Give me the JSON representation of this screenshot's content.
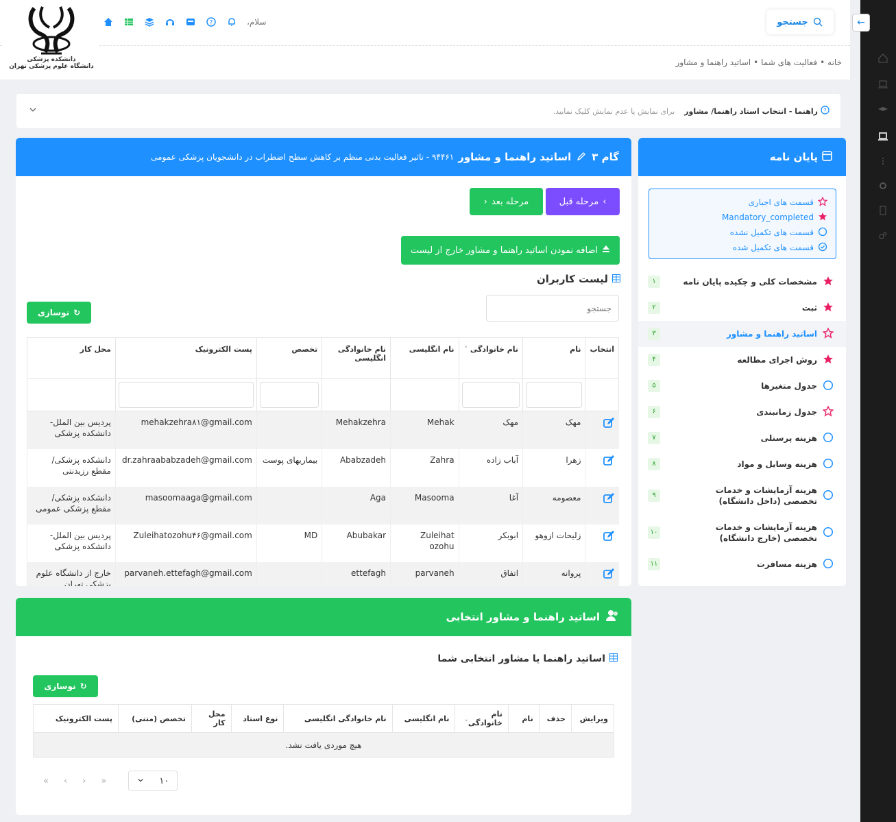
{
  "header": {
    "hello": "سلام،",
    "search_label": "جستجو",
    "logo_line1": "دانشکده پزشکی",
    "logo_line2": "دانشگاه علوم پزشکی تهران"
  },
  "breadcrumb": [
    "خانه",
    "فعالیت های شما",
    "اساتید راهنما و مشاور"
  ],
  "guide": {
    "title": "راهنما - انتخاب استاد راهنما/ مشاور",
    "hint": "برای نمایش یا عدم نمایش کلیک نمایید."
  },
  "step": {
    "label": "گام ۳",
    "title": "اساتید راهنما و مشاور",
    "subtitle": "۹۴۴۶۱ - تاثیر فعالیت بدنی منظم بر کاهش سطح اضطراب در دانشجویان پزشکی عمومی",
    "prev_label": "مرحله قبل",
    "next_label": "مرحله بعد",
    "add_label": "اضافه نمودن اساتید راهنما و مشاور خارج از لیست",
    "users_title": "لیست کاربران",
    "search_placeholder": "جستجو",
    "refresh_label": "نوسازی"
  },
  "users_table": {
    "columns": [
      "انتخاب",
      "نام",
      "نام خانوادگی",
      "نام انگلیسی",
      "نام خانوادگی انگلیسی",
      "تخصص",
      "پست الکترونیک",
      "محل کار"
    ],
    "rows": [
      {
        "first": "مهک",
        "last": "مهک",
        "en_first": "Mehak",
        "en_last": "Mehakzehra",
        "spec": "",
        "email": "mehakzehra۸۱@gmail.com",
        "work": "پردیس بین الملل- دانشکده پزشکی"
      },
      {
        "first": "زهرا",
        "last": "آباب زاده",
        "en_first": "Zahra",
        "en_last": "Ababzadeh",
        "spec": "بیماریهای پوست",
        "email": "dr.zahraababzadeh@gmail.com",
        "work": "دانشکده پزشکی/ مقطع رزیدنتی"
      },
      {
        "first": "معصومه",
        "last": "آغا",
        "en_first": "Masooma",
        "en_last": "Aga",
        "spec": "",
        "email": "masoomaaga@gmail.com",
        "work": "دانشکده پزشکی/ مقطع پزشکی عمومی"
      },
      {
        "first": "زلیحات ازوهو",
        "last": "ابوبکر",
        "en_first": "Zuleihat ozohu",
        "en_last": "Abubakar",
        "spec": "MD",
        "email": "Zuleihatozohu۴۶@gmail.com",
        "work": "پردیس بین الملل- دانشکده پزشکی"
      },
      {
        "first": "پروانه",
        "last": "اتفاق",
        "en_first": "parvaneh",
        "en_last": "ettefagh",
        "spec": "",
        "email": "parvaneh.ettefagh@gmail.com",
        "work": "خارج از دانشگاه علوم پزشکی تهران"
      }
    ]
  },
  "sidebar": {
    "title": "پایان نامه",
    "legend": [
      "قسمت های اجباری",
      "Mandatory_completed",
      "قسمت های تکمیل نشده",
      "قسمت های تکمیل شده"
    ],
    "items": [
      {
        "label": "مشخصات کلی و چکیده پایان نامه",
        "num": "۱",
        "icon": "star-filled"
      },
      {
        "label": "ثبت",
        "num": "۲",
        "icon": "star-filled"
      },
      {
        "label": "اساتید راهنما و مشاور",
        "num": "۳",
        "icon": "star-outline"
      },
      {
        "label": "روش اجرای مطالعه",
        "num": "۴",
        "icon": "star-filled"
      },
      {
        "label": "جدول متغیرها",
        "num": "۵",
        "icon": "circle"
      },
      {
        "label": "جدول زمانبندی",
        "num": "۶",
        "icon": "star-outline"
      },
      {
        "label": "هزینه پرسنلی",
        "num": "۷",
        "icon": "circle"
      },
      {
        "label": "هزینه وسایل و مواد",
        "num": "۸",
        "icon": "circle"
      },
      {
        "label": "هزینه آزمایشات و خدمات تخصصی (داخل دانشگاه)",
        "num": "۹",
        "icon": "circle"
      },
      {
        "label": "هزینه آزمایشات و خدمات تخصصی (خارج دانشگاه)",
        "num": "۱۰",
        "icon": "circle"
      },
      {
        "label": "هزینه مسافرت",
        "num": "۱۱",
        "icon": "circle"
      }
    ]
  },
  "selected": {
    "title": "اساتید راهنما و مشاور انتخابی",
    "subtitle": "اساتید راهنما یا مشاور انتخابی شما",
    "refresh_label": "نوسازی",
    "columns": [
      "ویرایش",
      "حذف",
      "نام",
      "نام خانوادگی",
      "نام انگلیسی",
      "نام خانوادگی انگلیسی",
      "نوع استاد",
      "محل کار",
      "تخصص (متنی)",
      "پست الکترونیک"
    ],
    "empty": "هیچ موردی یافت نشد.",
    "page_size": "۱۰"
  },
  "colors": {
    "primary": "#1e90ff",
    "success": "#22c55e",
    "purple": "#7c4dff",
    "star": "#e91e63"
  }
}
